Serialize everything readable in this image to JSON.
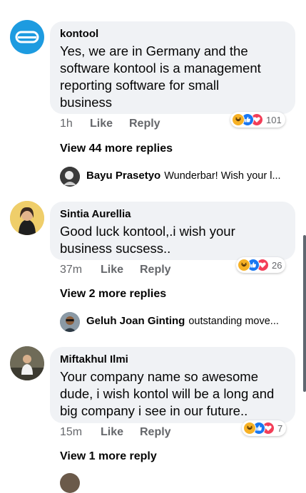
{
  "comments": [
    {
      "author": "kontool",
      "text": "Yes, we are in Germany and the\nsoftware kontool is a management\nreporting software for small\nbusiness",
      "time": "1h",
      "like_label": "Like",
      "reply_label": "Reply",
      "reaction_count": "101",
      "view_more": "View 44 more replies",
      "preview": {
        "author": "Bayu Prasetyo",
        "text": "Wunderbar!  Wish your l..."
      }
    },
    {
      "author": "Sintia Aurellia",
      "text": "Good luck kontool,.i wish your\nbusiness sucsess..",
      "time": "37m",
      "like_label": "Like",
      "reply_label": "Reply",
      "reaction_count": "26",
      "view_more": "View 2 more replies",
      "preview": {
        "author": "Geluh Joan Ginting",
        "text": "outstanding move..."
      }
    },
    {
      "author": "Miftakhul Ilmi",
      "text": "Your company name so awesome\ndude, i wish kontol will be a long and\nbig company i see in our future..",
      "time": "15m",
      "like_label": "Like",
      "reply_label": "Reply",
      "reaction_count": "7",
      "view_more": "View 1 more reply"
    }
  ],
  "reaction_icons": [
    "haha-icon",
    "like-icon",
    "love-icon"
  ],
  "colors": {
    "bubble": "#f0f2f5",
    "meta": "#65676b",
    "like_blue": "#1877f2",
    "love_red": "#f33e58",
    "haha_yellow": "#f7b125",
    "kontool_logo": "#1d9be0"
  }
}
